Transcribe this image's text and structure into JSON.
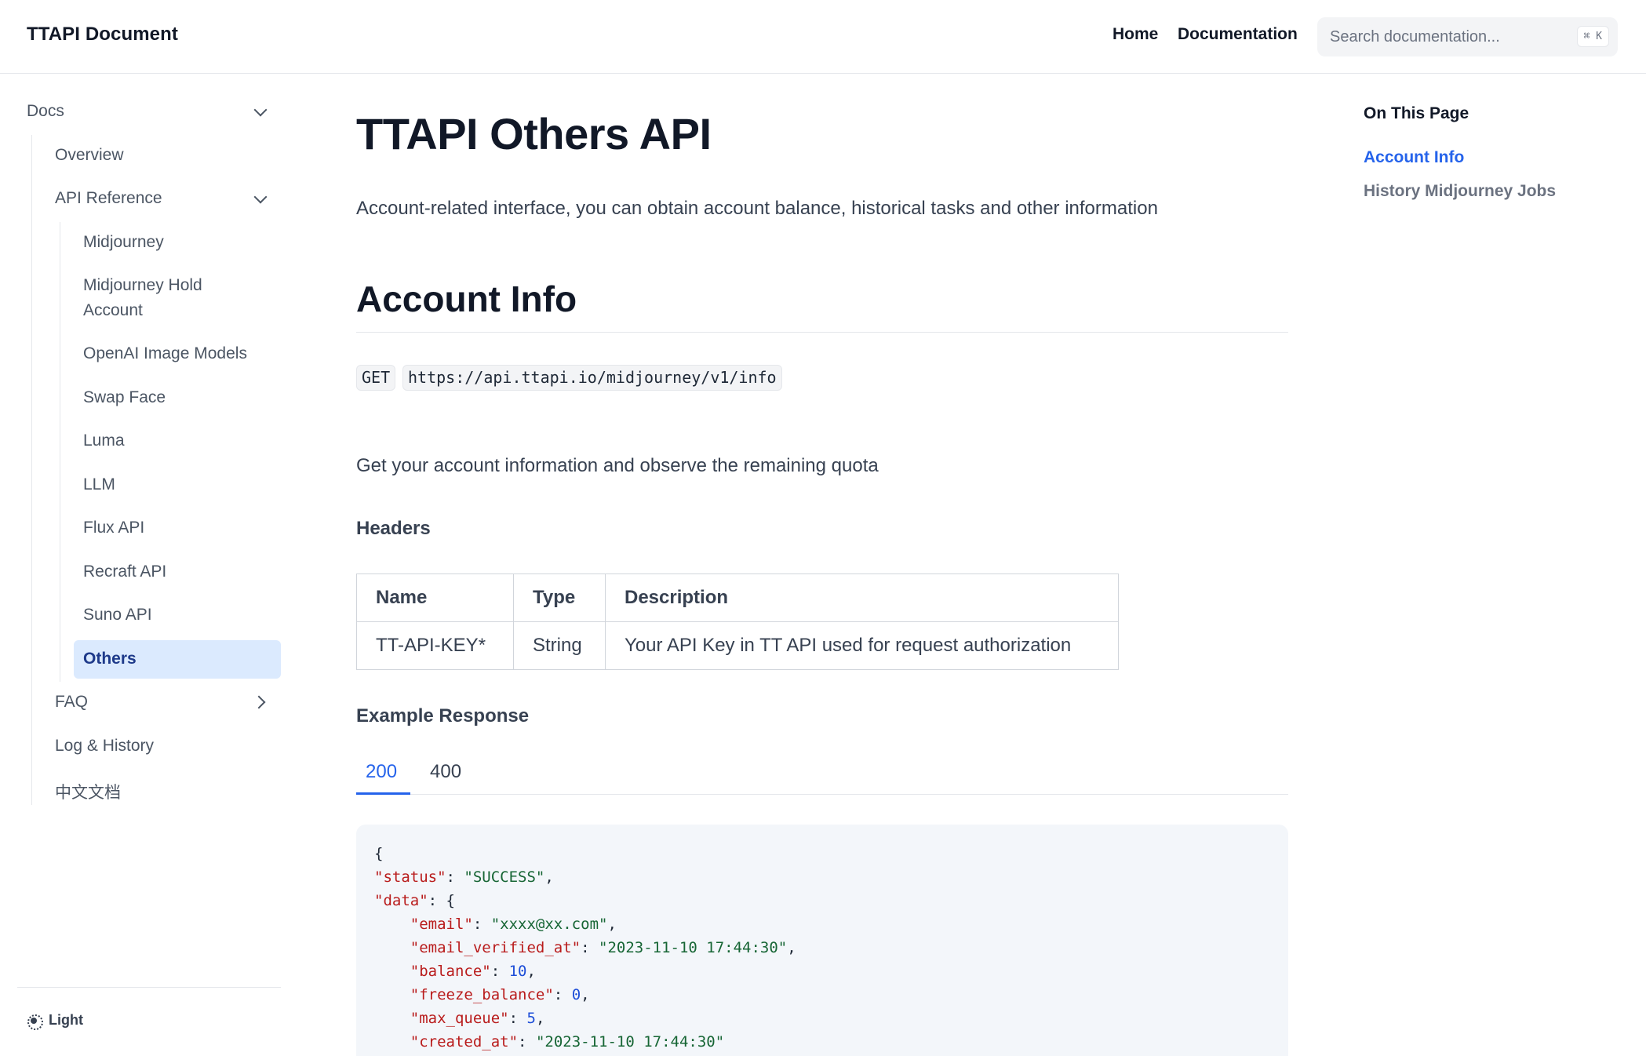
{
  "header": {
    "brand": "TTAPI Document",
    "nav": [
      "Home",
      "Documentation"
    ],
    "search_placeholder": "Search documentation...",
    "search_shortcut": "⌘ K"
  },
  "sidebar": {
    "root": "Docs",
    "overview": "Overview",
    "api_reference": "API Reference",
    "api_items": [
      "Midjourney",
      "Midjourney Hold",
      "Account",
      "OpenAI Image Models",
      "Swap Face",
      "Luma",
      "LLM",
      "Flux API",
      "Recraft API",
      "Suno API",
      "Others"
    ],
    "faq": "FAQ",
    "log_history": "Log & History",
    "chinese_docs": "中文文档",
    "theme_label": "Light"
  },
  "main": {
    "title": "TTAPI Others API",
    "lead": "Account-related interface, you can obtain account balance, historical tasks and other information",
    "section_title": "Account Info",
    "method": "GET",
    "url": "https://api.ttapi.io/midjourney/v1/info",
    "description": "Get your account information and observe the remaining quota",
    "headers_title": "Headers",
    "headers_table": {
      "columns": [
        "Name",
        "Type",
        "Description"
      ],
      "rows": [
        [
          "TT-API-KEY*",
          "String",
          "Your API Key in TT API used for request authorization"
        ]
      ]
    },
    "example_title": "Example Response",
    "tabs": [
      "200",
      "400"
    ],
    "code": {
      "open": "{",
      "status_key": "\"status\"",
      "status_val": "\"SUCCESS\"",
      "data_key": "\"data\"",
      "email_key": "\"email\"",
      "email_val": "\"xxxx@xx.com\"",
      "verified_key": "\"email_verified_at\"",
      "verified_val": "\"2023-11-10 17:44:30\"",
      "balance_key": "\"balance\"",
      "balance_val": "10",
      "freeze_key": "\"freeze_balance\"",
      "freeze_val": "0",
      "queue_key": "\"max_queue\"",
      "queue_val": "5",
      "created_key": "\"created_at\"",
      "created_val": "\"2023-11-10 17:44:30\""
    }
  },
  "toc": {
    "title": "On This Page",
    "items": [
      "Account Info",
      "History Midjourney Jobs"
    ]
  },
  "colors": {
    "accent": "#2563eb",
    "active_bg": "#dbeafe",
    "code_bg": "#f3f6fa"
  }
}
